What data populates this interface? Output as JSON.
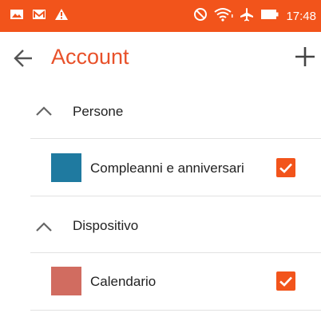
{
  "status_bar": {
    "time": "17:48",
    "left_icons": [
      "gallery-icon",
      "mail-icon",
      "warning-icon"
    ],
    "right_icons": [
      "do-not-disturb-icon",
      "wifi-icon",
      "airplane-mode-icon",
      "battery-icon"
    ],
    "color": "#f2541b"
  },
  "app_bar": {
    "title": "Account",
    "title_color": "#e8512a"
  },
  "groups": [
    {
      "label": "Persone",
      "expanded": true,
      "items": [
        {
          "label": "Compleanni e anniversari",
          "color": "#1f7aa0",
          "checked": true
        }
      ]
    },
    {
      "label": "Dispositivo",
      "expanded": true,
      "items": [
        {
          "label": "Calendario",
          "color": "#d16c60",
          "checked": true
        }
      ]
    }
  ]
}
